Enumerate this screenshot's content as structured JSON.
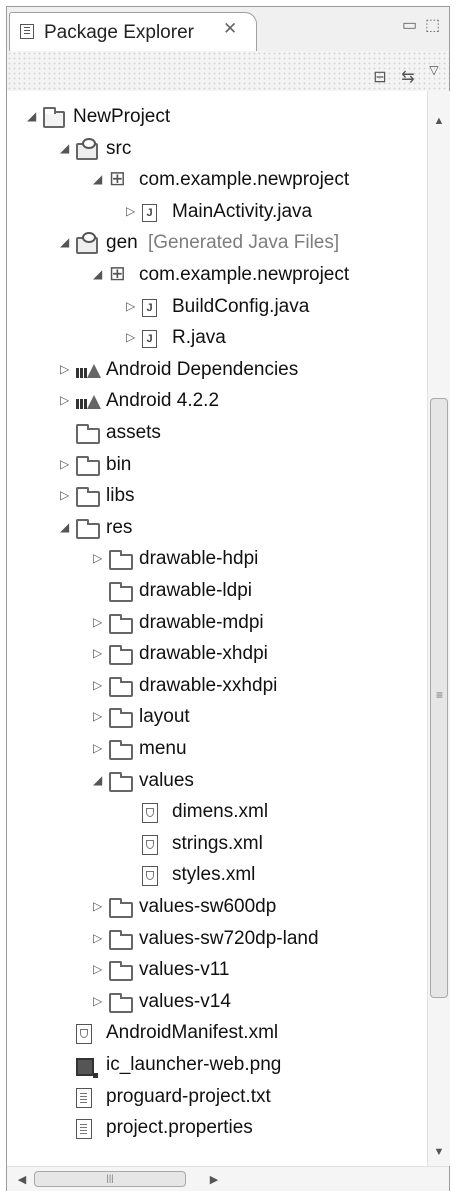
{
  "view": {
    "title": "Package Explorer",
    "close_glyph": "✕",
    "minimize_glyph": "▭",
    "maximize_glyph": "⬚",
    "menu_glyph": "▽",
    "collapse_all_glyph": "⊟",
    "link_glyph": "⇆"
  },
  "tree": [
    {
      "label": "NewProject",
      "decoration": "",
      "icon": "project-icon",
      "expanded": true
    },
    {
      "label": "src",
      "decoration": "",
      "icon": "source-folder-icon",
      "expanded": true
    },
    {
      "label": "com.example.newproject",
      "decoration": "",
      "icon": "package-icon",
      "expanded": true
    },
    {
      "label": "MainActivity.java",
      "decoration": "",
      "icon": "java-file-icon",
      "expanded": false
    },
    {
      "label": "gen",
      "decoration": "[Generated Java Files]",
      "icon": "source-folder-icon",
      "expanded": true
    },
    {
      "label": "com.example.newproject",
      "decoration": "",
      "icon": "package-icon",
      "expanded": true
    },
    {
      "label": "BuildConfig.java",
      "decoration": "",
      "icon": "java-file-icon",
      "expanded": false
    },
    {
      "label": "R.java",
      "decoration": "",
      "icon": "java-file-icon",
      "expanded": false
    },
    {
      "label": "Android Dependencies",
      "decoration": "",
      "icon": "library-icon",
      "expanded": false
    },
    {
      "label": "Android 4.2.2",
      "decoration": "",
      "icon": "library-icon",
      "expanded": false
    },
    {
      "label": "assets",
      "decoration": "",
      "icon": "folder-icon",
      "expanded": null
    },
    {
      "label": "bin",
      "decoration": "",
      "icon": "folder-icon",
      "expanded": false
    },
    {
      "label": "libs",
      "decoration": "",
      "icon": "folder-icon",
      "expanded": false
    },
    {
      "label": "res",
      "decoration": "",
      "icon": "folder-icon",
      "expanded": true
    },
    {
      "label": "drawable-hdpi",
      "decoration": "",
      "icon": "folder-icon",
      "expanded": false
    },
    {
      "label": "drawable-ldpi",
      "decoration": "",
      "icon": "folder-icon",
      "expanded": null
    },
    {
      "label": "drawable-mdpi",
      "decoration": "",
      "icon": "folder-icon",
      "expanded": false
    },
    {
      "label": "drawable-xhdpi",
      "decoration": "",
      "icon": "folder-icon",
      "expanded": false
    },
    {
      "label": "drawable-xxhdpi",
      "decoration": "",
      "icon": "folder-icon",
      "expanded": false
    },
    {
      "label": "layout",
      "decoration": "",
      "icon": "folder-icon",
      "expanded": false
    },
    {
      "label": "menu",
      "decoration": "",
      "icon": "folder-icon",
      "expanded": false
    },
    {
      "label": "values",
      "decoration": "",
      "icon": "folder-icon",
      "expanded": true
    },
    {
      "label": "dimens.xml",
      "decoration": "",
      "icon": "xml-file-icon",
      "expanded": null
    },
    {
      "label": "strings.xml",
      "decoration": "",
      "icon": "xml-file-icon",
      "expanded": null
    },
    {
      "label": "styles.xml",
      "decoration": "",
      "icon": "xml-file-icon",
      "expanded": null
    },
    {
      "label": "values-sw600dp",
      "decoration": "",
      "icon": "folder-icon",
      "expanded": false
    },
    {
      "label": "values-sw720dp-land",
      "decoration": "",
      "icon": "folder-icon",
      "expanded": false
    },
    {
      "label": "values-v11",
      "decoration": "",
      "icon": "folder-icon",
      "expanded": false
    },
    {
      "label": "values-v14",
      "decoration": "",
      "icon": "folder-icon",
      "expanded": false
    },
    {
      "label": "AndroidManifest.xml",
      "decoration": "",
      "icon": "xml-file-icon",
      "expanded": null
    },
    {
      "label": "ic_launcher-web.png",
      "decoration": "",
      "icon": "image-file-icon",
      "expanded": null
    },
    {
      "label": "proguard-project.txt",
      "decoration": "",
      "icon": "text-file-icon",
      "expanded": null
    },
    {
      "label": "project.properties",
      "decoration": "",
      "icon": "text-file-icon",
      "expanded": null
    }
  ]
}
